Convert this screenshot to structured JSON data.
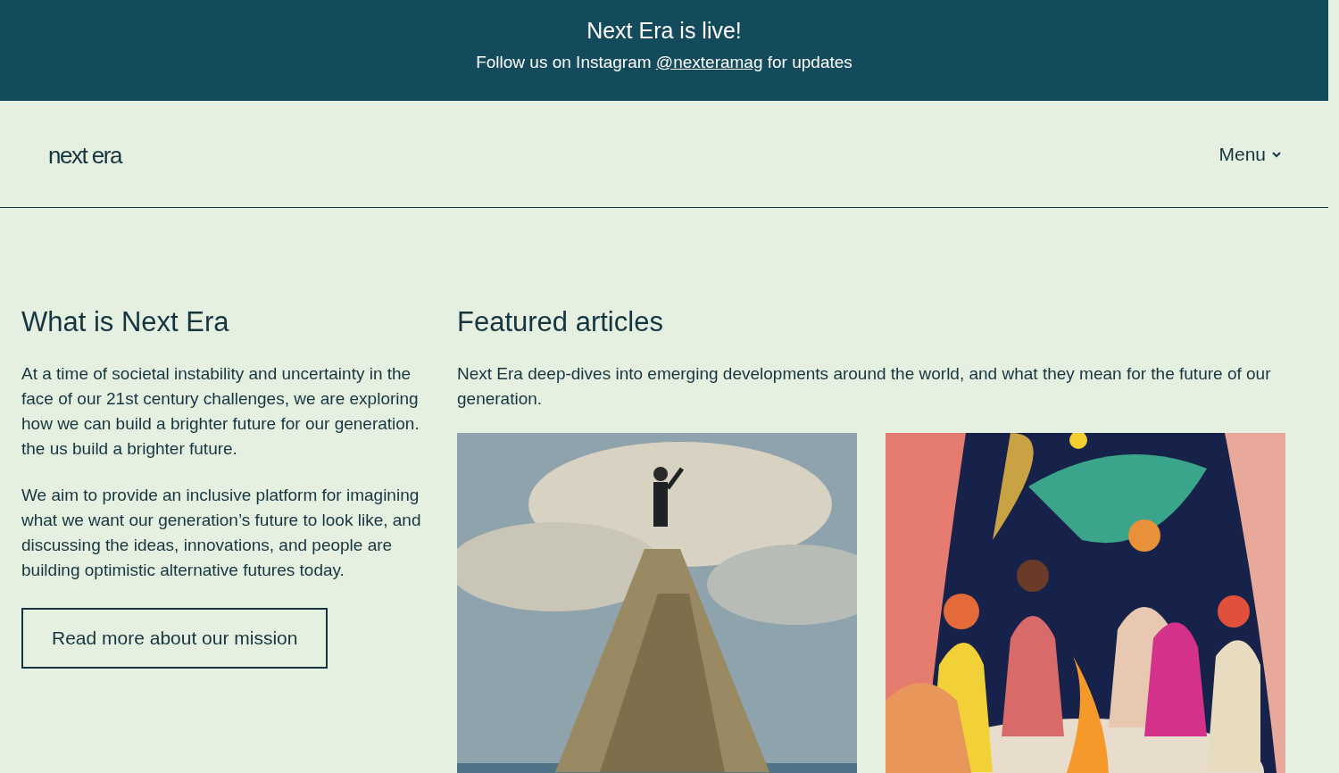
{
  "banner": {
    "title": "Next Era is live!",
    "text_before": "Follow us on Instagram",
    "link": "@nexteramag",
    "text_after": "for updates"
  },
  "header": {
    "logo": "next era",
    "menu": "Menu"
  },
  "about": {
    "heading": "What is Next Era",
    "paragraphs": [
      "At a time of societal instability and uncertainty in the face of our 21st century challenges, we are exploring how we can build a brighter future for our generation. the us build a brighter future.",
      "We aim to provide an inclusive platform for imagining what we want our generation’s future to look like, and discussing the ideas, innovations, and people are building optimistic alternative futures today."
    ],
    "button": "Read more about our mission"
  },
  "featured": {
    "heading": "Featured articles",
    "intro": "Next Era deep-dives into emerging developments around the world, and what they mean for the future of our generation."
  }
}
